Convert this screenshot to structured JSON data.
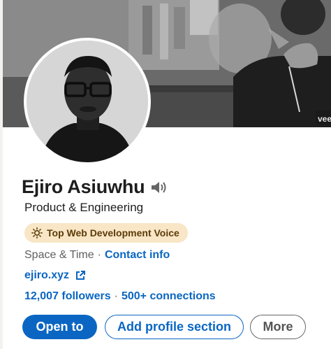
{
  "profile": {
    "name": "Ejiro Asiuwhu",
    "headline": "Product & Engineering",
    "voice_badge": "Top Web Development Voice",
    "location": "Space & Time",
    "separator": "·",
    "contact_info": "Contact info",
    "website": "ejiro.xyz",
    "followers": "12,007 followers",
    "connections": "500+ connections"
  },
  "actions": {
    "open_to": "Open to",
    "add_profile_section": "Add profile section",
    "more": "More"
  },
  "colors": {
    "accent": "#0a66c2",
    "badge_bg": "#f8e6c6",
    "badge_text": "#5c3b09"
  },
  "icons": {
    "speaker": "speaker-icon",
    "sun": "sun-icon",
    "external_link": "external-link-icon"
  }
}
